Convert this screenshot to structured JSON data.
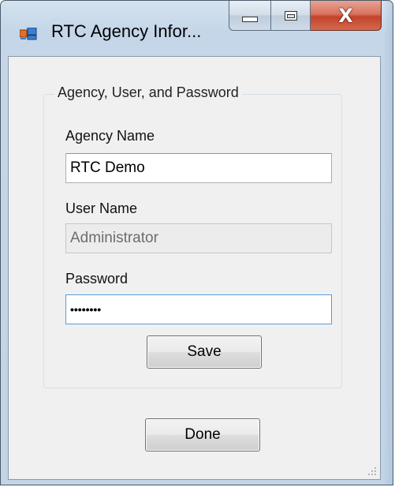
{
  "window": {
    "title": "RTC Agency Infor...",
    "icons": {
      "app": "form-window-icon",
      "minimize": "minimize-icon",
      "maximize": "maximize-icon",
      "close": "close-icon"
    },
    "close_glyph": "X"
  },
  "group": {
    "caption": "Agency, User, and Password"
  },
  "fields": {
    "agency_name": {
      "label": "Agency Name",
      "value": "RTC Demo"
    },
    "user_name": {
      "label": "User Name",
      "value": "Administrator",
      "disabled": true
    },
    "password": {
      "label": "Password",
      "masked_value": "••••••••"
    }
  },
  "buttons": {
    "save_label": "Save",
    "done_label": "Done"
  },
  "colors": {
    "close_button": "#c2432a",
    "client_bg": "#f0f0f0",
    "focus_border": "#5a9bd5"
  }
}
